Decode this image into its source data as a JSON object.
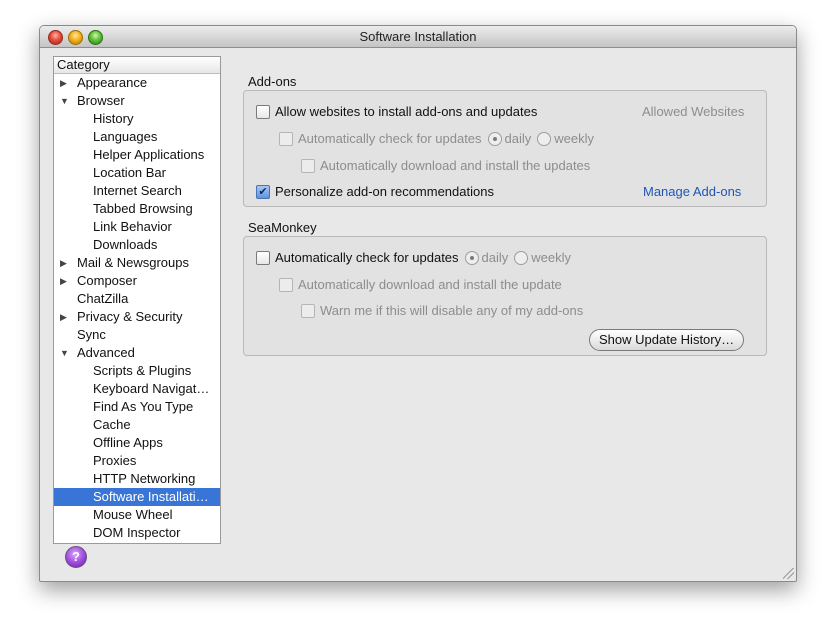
{
  "window": {
    "title": "Software Installation"
  },
  "tree": {
    "header": "Category",
    "items": [
      {
        "label": "Appearance",
        "arrow": "▶"
      },
      {
        "label": "Browser",
        "arrow": "▼"
      },
      {
        "label": "History"
      },
      {
        "label": "Languages"
      },
      {
        "label": "Helper Applications"
      },
      {
        "label": "Location Bar"
      },
      {
        "label": "Internet Search"
      },
      {
        "label": "Tabbed Browsing"
      },
      {
        "label": "Link Behavior"
      },
      {
        "label": "Downloads"
      },
      {
        "label": "Mail & Newsgroups",
        "arrow": "▶"
      },
      {
        "label": "Composer",
        "arrow": "▶"
      },
      {
        "label": "ChatZilla"
      },
      {
        "label": "Privacy & Security",
        "arrow": "▶"
      },
      {
        "label": "Sync"
      },
      {
        "label": "Advanced",
        "arrow": "▼"
      },
      {
        "label": "Scripts & Plugins"
      },
      {
        "label": "Keyboard Navigat…"
      },
      {
        "label": "Find As You Type"
      },
      {
        "label": "Cache"
      },
      {
        "label": "Offline Apps"
      },
      {
        "label": "Proxies"
      },
      {
        "label": "HTTP Networking"
      },
      {
        "label": "Software Installati…"
      },
      {
        "label": "Mouse Wheel"
      },
      {
        "label": "DOM Inspector"
      }
    ]
  },
  "help": {
    "label": "?"
  },
  "addons": {
    "title": "Add-ons",
    "allow_label": "Allow websites to install add-ons and updates",
    "allowed_websites": "Allowed Websites",
    "auto_check_label": "Automatically check for updates",
    "daily": "daily",
    "weekly": "weekly",
    "auto_download_label": "Automatically download and install the updates",
    "personalize_label": "Personalize add-on recommendations",
    "personalize_check": "✔",
    "manage_addons": "Manage Add-ons"
  },
  "seamonkey": {
    "title": "SeaMonkey",
    "auto_check_label": "Automatically check for updates",
    "daily": "daily",
    "weekly": "weekly",
    "auto_download_label": "Automatically download and install the update",
    "warn_label": "Warn me if this will disable any of my add-ons",
    "show_history": "Show Update History…"
  }
}
